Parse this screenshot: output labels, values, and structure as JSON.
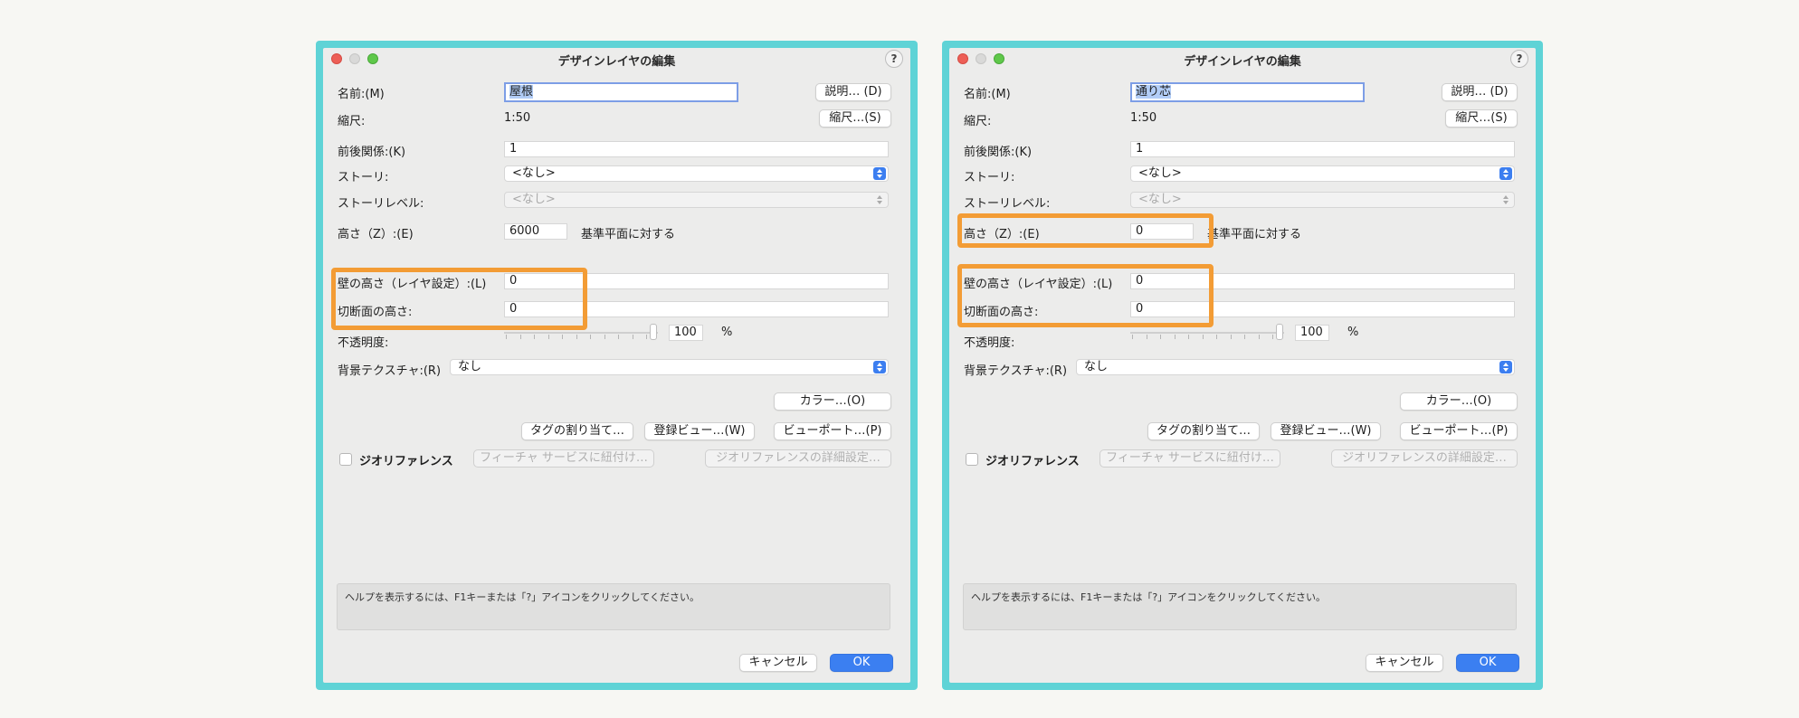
{
  "colors": {
    "frame": "#5fd3d6",
    "highlight": "#f39c35",
    "accent": "#3b7ff1"
  },
  "dialogs": [
    {
      "title": "デザインレイヤの編集",
      "help_button": "?",
      "name_label": "名前:(M)",
      "name_value": "屋根",
      "describe_button": "説明… (D)",
      "scale_label": "縮尺:",
      "scale_value": "1:50",
      "scale_button": "縮尺…(S)",
      "order_label": "前後関係:(K)",
      "order_value": "1",
      "story_label": "ストーリ:",
      "story_value": "<なし>",
      "story_level_label": "ストーリレベル:",
      "story_level_value": "<なし>",
      "height_label": "高さ（Z）:(E)",
      "height_value": "6000",
      "height_note": "基準平面に対する",
      "wall_height_label": "壁の高さ（レイヤ設定）:(L)",
      "wall_height_value": "0",
      "cut_height_label": "切断面の高さ:",
      "cut_height_value": "0",
      "opacity_label": "不透明度:",
      "opacity_value": "100",
      "opacity_unit": "%",
      "bg_texture_label": "背景テクスチャ:(R)",
      "bg_texture_value": "なし",
      "color_button": "カラー…(O)",
      "tag_button": "タグの割り当て…",
      "saved_view_button": "登録ビュー…(W)",
      "viewport_button": "ビューポート…(P)",
      "georef_label": "ジオリファレンス",
      "feature_service_button": "フィーチャ サービスに紐付け…",
      "georef_detail_button": "ジオリファレンスの詳細設定…",
      "help_text": "ヘルプを表示するには、F1キーまたは「?」アイコンをクリックしてください。",
      "cancel_button": "キャンセル",
      "ok_button": "OK"
    },
    {
      "title": "デザインレイヤの編集",
      "help_button": "?",
      "name_label": "名前:(M)",
      "name_value": "通り芯",
      "describe_button": "説明… (D)",
      "scale_label": "縮尺:",
      "scale_value": "1:50",
      "scale_button": "縮尺…(S)",
      "order_label": "前後関係:(K)",
      "order_value": "1",
      "story_label": "ストーリ:",
      "story_value": "<なし>",
      "story_level_label": "ストーリレベル:",
      "story_level_value": "<なし>",
      "height_label": "高さ（Z）:(E)",
      "height_value": "0",
      "height_note": "基準平面に対する",
      "wall_height_label": "壁の高さ（レイヤ設定）:(L)",
      "wall_height_value": "0",
      "cut_height_label": "切断面の高さ:",
      "cut_height_value": "0",
      "opacity_label": "不透明度:",
      "opacity_value": "100",
      "opacity_unit": "%",
      "bg_texture_label": "背景テクスチャ:(R)",
      "bg_texture_value": "なし",
      "color_button": "カラー…(O)",
      "tag_button": "タグの割り当て…",
      "saved_view_button": "登録ビュー…(W)",
      "viewport_button": "ビューポート…(P)",
      "georef_label": "ジオリファレンス",
      "feature_service_button": "フィーチャ サービスに紐付け…",
      "georef_detail_button": "ジオリファレンスの詳細設定…",
      "help_text": "ヘルプを表示するには、F1キーまたは「?」アイコンをクリックしてください。",
      "cancel_button": "キャンセル",
      "ok_button": "OK"
    }
  ]
}
